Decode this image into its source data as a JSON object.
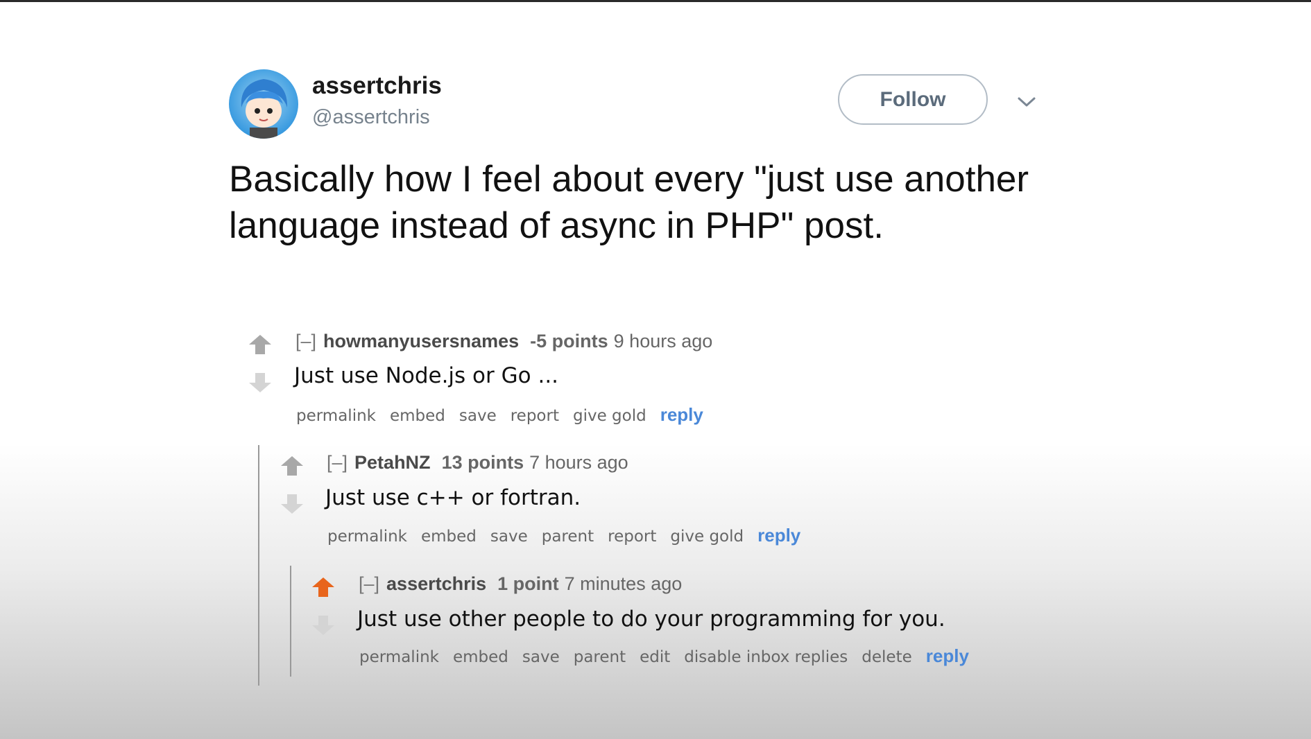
{
  "tweet": {
    "display_name": "assertchris",
    "handle": "@assertchris",
    "follow_label": "Follow",
    "text": "Basically how I feel about every \"just use another language instead of async in PHP\" post."
  },
  "comments": [
    {
      "collapse": "[–]",
      "author": "howmanyusersnames",
      "points": "-5 points",
      "time": "9 hours ago",
      "body": "Just use Node.js or Go ...",
      "upvoted": false,
      "actions": [
        "permalink",
        "embed",
        "save",
        "report",
        "give gold"
      ],
      "reply": "reply"
    },
    {
      "collapse": "[–]",
      "author": "PetahNZ",
      "points": "13 points",
      "time": "7 hours ago",
      "body": "Just use c++ or fortran.",
      "upvoted": false,
      "actions": [
        "permalink",
        "embed",
        "save",
        "parent",
        "report",
        "give gold"
      ],
      "reply": "reply"
    },
    {
      "collapse": "[–]",
      "author": "assertchris",
      "points": "1 point",
      "time": "7 minutes ago",
      "body": "Just use other people to do your programming for you.",
      "upvoted": true,
      "actions": [
        "permalink",
        "embed",
        "save",
        "parent",
        "edit",
        "disable inbox replies",
        "delete"
      ],
      "reply": "reply"
    }
  ],
  "colors": {
    "upvote_active": "#e8651c",
    "vote_inactive": "#a8a8a8",
    "reply_link": "#4a88d8"
  },
  "icons": {
    "menu": "chevron-down-icon",
    "upvote": "upvote-arrow-icon",
    "downvote": "downvote-arrow-icon"
  }
}
